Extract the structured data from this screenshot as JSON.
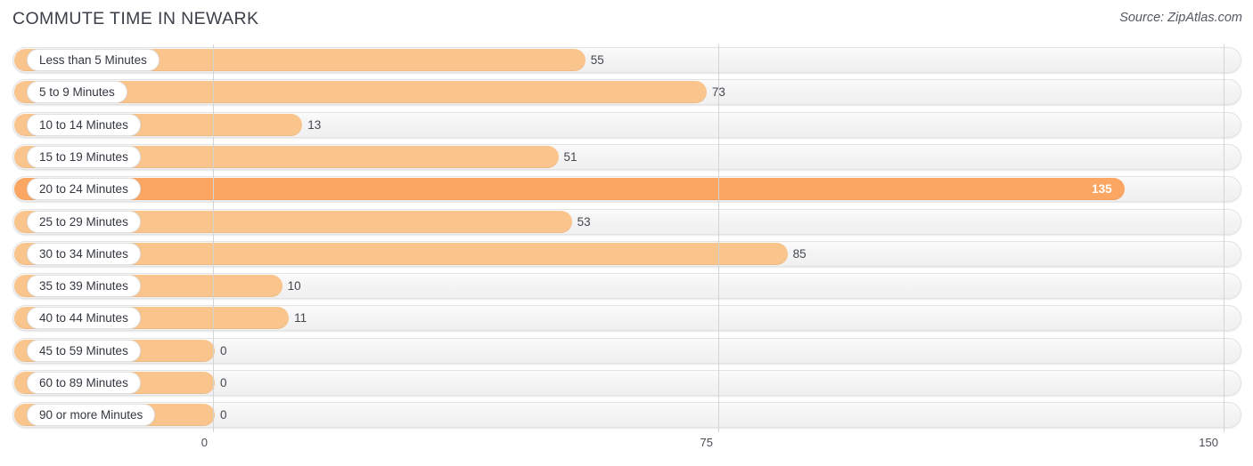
{
  "header": {
    "title": "COMMUTE TIME IN NEWARK",
    "source": "Source: ZipAtlas.com"
  },
  "chart_data": {
    "type": "bar",
    "orientation": "horizontal",
    "title": "COMMUTE TIME IN NEWARK",
    "xlabel": "",
    "ylabel": "",
    "xlim": [
      0,
      150
    ],
    "ticks": [
      "0",
      "75",
      "150"
    ],
    "tick_values": [
      0,
      75,
      150
    ],
    "grid": true,
    "legend": null,
    "categories": [
      "Less than 5 Minutes",
      "5 to 9 Minutes",
      "10 to 14 Minutes",
      "15 to 19 Minutes",
      "20 to 24 Minutes",
      "25 to 29 Minutes",
      "30 to 34 Minutes",
      "35 to 39 Minutes",
      "40 to 44 Minutes",
      "45 to 59 Minutes",
      "60 to 89 Minutes",
      "90 or more Minutes"
    ],
    "values": [
      55,
      73,
      13,
      51,
      135,
      53,
      85,
      10,
      11,
      0,
      0,
      0
    ],
    "value_labels": [
      "55",
      "73",
      "13",
      "51",
      "135",
      "53",
      "85",
      "10",
      "11",
      "0",
      "0",
      "0"
    ],
    "max_value": 135,
    "max_index": 4,
    "colors": {
      "bar": "#fac48d",
      "bar_max": "#fba662",
      "track": "#f4f4f4",
      "gridline": "#d4d4d4",
      "text": "#33373f",
      "title": "#3c4049"
    }
  }
}
